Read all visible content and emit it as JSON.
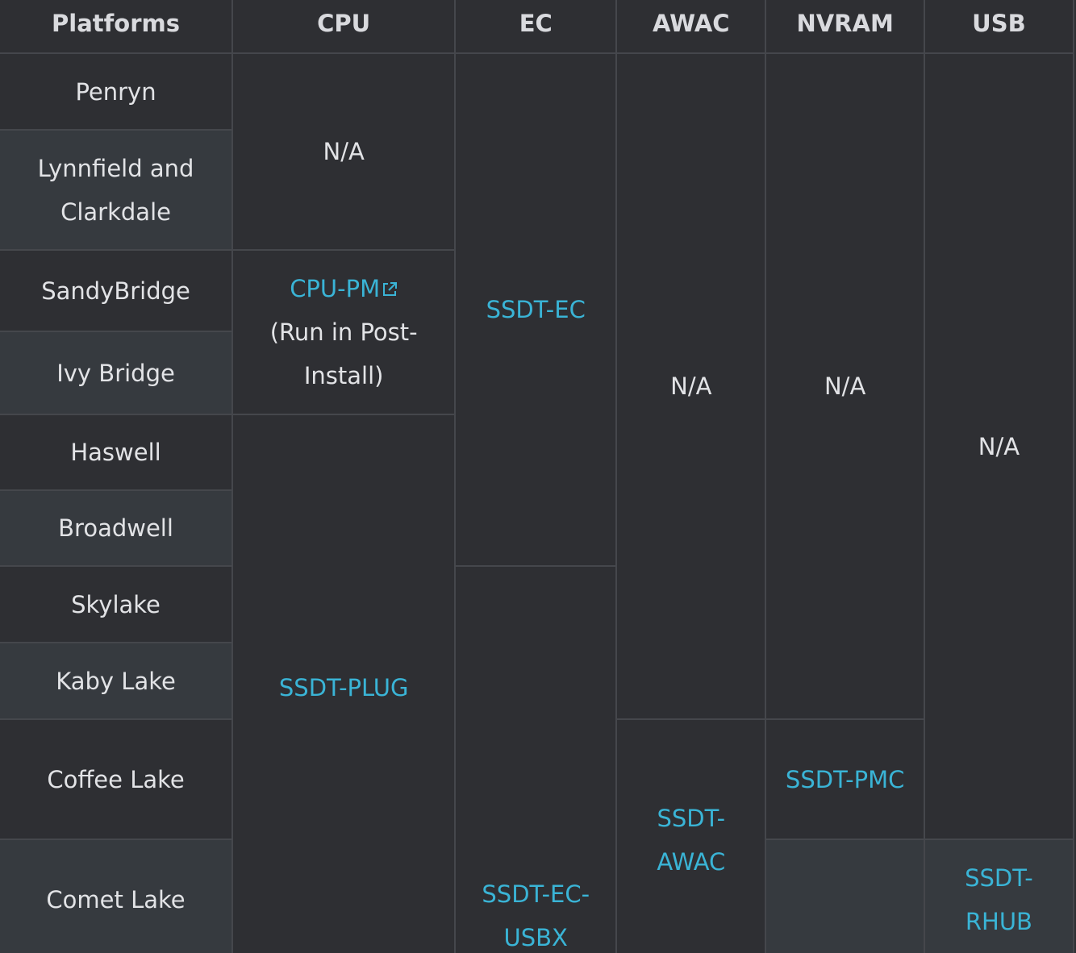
{
  "headers": {
    "platforms": "Platforms",
    "cpu": "CPU",
    "ec": "EC",
    "awac": "AWAC",
    "nvram": "NVRAM",
    "usb": "USB"
  },
  "platforms": [
    "Penryn",
    "Lynnfield and Clarkdale",
    "SandyBridge",
    "Ivy Bridge",
    "Haswell",
    "Broadwell",
    "Skylake",
    "Kaby Lake",
    "Coffee Lake",
    "Comet Lake"
  ],
  "cells": {
    "cpu_early": "N/A",
    "cpu_pm_link": "CPU-PM",
    "cpu_pm_note": "(Run in Post-Install)",
    "cpu_plug": "SSDT-PLUG",
    "ec_early": "SSDT-EC",
    "ec_late": "SSDT-EC-USBX",
    "awac_early": "N/A",
    "awac_late": "SSDT-AWAC",
    "nvram_early": "N/A",
    "nvram_late": "SSDT-PMC",
    "nvram_comet": "",
    "usb_early": "N/A",
    "usb_late": "SSDT-RHUB"
  },
  "colors": {
    "background": "#2e2f33",
    "alt_row": "#363a3f",
    "border": "#45474c",
    "text": "#e2e3e6",
    "link": "#3ab4d6"
  },
  "icons": {
    "external_link": "external-link-icon"
  }
}
